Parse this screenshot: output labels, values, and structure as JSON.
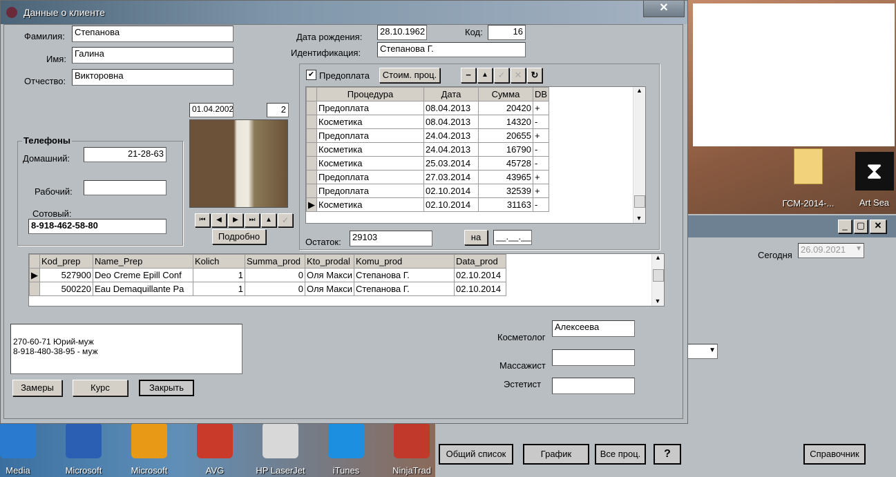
{
  "window": {
    "title": "Данные о клиенте",
    "close_glyph": "✕"
  },
  "client": {
    "surname_label": "Фамилия:",
    "surname": "Степанова",
    "name_label": "Имя:",
    "name": "Галина",
    "patronymic_label": "Отчество:",
    "patronymic": "Викторовна",
    "dob_label": "Дата рождения:",
    "dob": "28.10.1962",
    "code_label": "Код:",
    "code": "16",
    "ident_label": "Идентификация:",
    "ident": "Степанова  Г."
  },
  "photo": {
    "date": "01.04.2002",
    "index": "2",
    "details_button": "Подробно"
  },
  "phones": {
    "title": "Телефоны",
    "home_label": "Домашний:",
    "home": "21-28-63",
    "work_label": "Рабочий:",
    "work": "",
    "mobile_label": "Сотовый:",
    "mobile": "8-918-462-58-80"
  },
  "procedures": {
    "prepay_label": "Предоплата",
    "cost_button": "Стоим. проц.",
    "columns": [
      "Процедура",
      "Дата",
      "Сумма",
      "DB"
    ],
    "rows": [
      [
        "Предоплата",
        "08.04.2013",
        "20420",
        "+"
      ],
      [
        "Косметика",
        "08.04.2013",
        "14320",
        "-"
      ],
      [
        "Предоплата",
        "24.04.2013",
        "20655",
        "+"
      ],
      [
        "Косметика",
        "24.04.2013",
        "16790",
        "-"
      ],
      [
        "Косметика",
        "25.03.2014",
        "45728",
        "-"
      ],
      [
        "Предоплата",
        "27.03.2014",
        "43965",
        "+"
      ],
      [
        "Предоплата",
        "02.10.2014",
        "32539",
        "+"
      ],
      [
        "Косметика",
        "02.10.2014",
        "31163",
        "-"
      ]
    ],
    "balance_label": "Остаток:",
    "balance": "29103",
    "on_button": "на",
    "on_date": "__.__.__"
  },
  "products": {
    "columns": [
      "Kod_prep",
      "Name_Prep",
      "Kolich",
      "Summa_prod",
      "Kto_prodal",
      "Komu_prod",
      "Data_prod"
    ],
    "rows": [
      [
        "527900",
        "Deo Creme Epill Conf",
        "1",
        "0",
        "Оля Макси",
        "Степанова  Г.",
        "02.10.2014"
      ],
      [
        "500220",
        "Eau Demaquillante Pa",
        "1",
        "0",
        "Оля Макси",
        "Степанова  Г.",
        "02.10.2014"
      ]
    ]
  },
  "notes": {
    "line1": "270-60-71 Юрий-муж",
    "line2": "8-918-480-38-95 - муж"
  },
  "staff": {
    "cosmetologist_label": "Косметолог",
    "cosmetologist": "Алексеева",
    "masseur_label": "Массажист",
    "masseur": "",
    "esthetician_label": "Эстетист",
    "esthetician": ""
  },
  "bottom_buttons": {
    "measures": "Замеры",
    "course": "Курс",
    "close": "Закрыть"
  },
  "background_window": {
    "today_label": "Сегодня",
    "today": "26.09.2021",
    "buttons": [
      "Общий список",
      "График",
      "Все проц.",
      "?",
      "Справочник"
    ]
  },
  "desktop": {
    "icons": [
      {
        "label": "ГСМ-2014-...",
        "icon": "folder-icon"
      },
      {
        "label": "Art Sea",
        "icon": "hourglass-icon"
      }
    ]
  },
  "taskbar": {
    "items": [
      {
        "label": "Media",
        "icon": "media-icon",
        "color": "#2a7bd0"
      },
      {
        "label": "Microsoft",
        "icon": "word-icon",
        "color": "#2b5fb4"
      },
      {
        "label": "Microsoft",
        "icon": "outlook-icon",
        "color": "#e89a17"
      },
      {
        "label": "AVG",
        "icon": "avg-icon",
        "color": "#c93a2b"
      },
      {
        "label": "HP LaserJet",
        "icon": "printer-icon",
        "color": "#d8d8d8"
      },
      {
        "label": "iTunes",
        "icon": "itunes-icon",
        "color": "#1d8fe0"
      },
      {
        "label": "NinjaTrad",
        "icon": "ninjatrader-icon",
        "color": "#c0392b"
      }
    ]
  }
}
